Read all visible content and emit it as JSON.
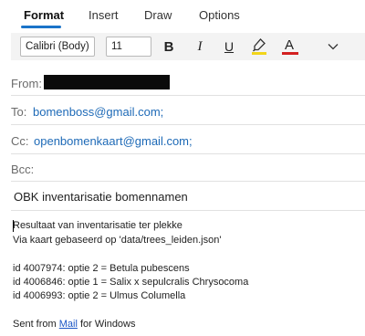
{
  "tabs": [
    {
      "label": "Format",
      "active": true
    },
    {
      "label": "Insert",
      "active": false
    },
    {
      "label": "Draw",
      "active": false
    },
    {
      "label": "Options",
      "active": false
    }
  ],
  "toolbar": {
    "font_family": "Calibri (Body)",
    "font_size": "11",
    "bold_label": "B",
    "italic_label": "I",
    "underline_label": "U",
    "font_color_label": "A",
    "highlight_color": "#f2d51a",
    "font_color": "#d32020",
    "icons": [
      "bold-icon",
      "italic-icon",
      "underline-icon",
      "highlighter-icon",
      "font-color-icon",
      "chevron-down-icon"
    ]
  },
  "header": {
    "from_label": "From:",
    "to_label": "To:",
    "to_value": "bomenboss@gmail.com;",
    "cc_label": "Cc:",
    "cc_value": "openbomenkaart@gmail.com;",
    "bcc_label": "Bcc:",
    "subject": "OBK inventarisatie bomennamen"
  },
  "body": {
    "line1": "Resultaat van inventarisatie ter plekke",
    "line2": "Via kaart gebaseerd op 'data/trees_leiden.json'",
    "line3": "id 4007974: optie 2 = Betula pubescens",
    "line4": "id 4006846: optie 1 = Salix x sepulcralis Chrysocoma",
    "line5": "id 4006993: optie 2 = Ulmus Columella",
    "sig_prefix": "Sent from ",
    "sig_link": "Mail",
    "sig_suffix": " for Windows"
  },
  "colors": {
    "accent": "#1a73c9",
    "link": "#1e6ab7",
    "toolbar_bg": "#f3f3f3"
  }
}
